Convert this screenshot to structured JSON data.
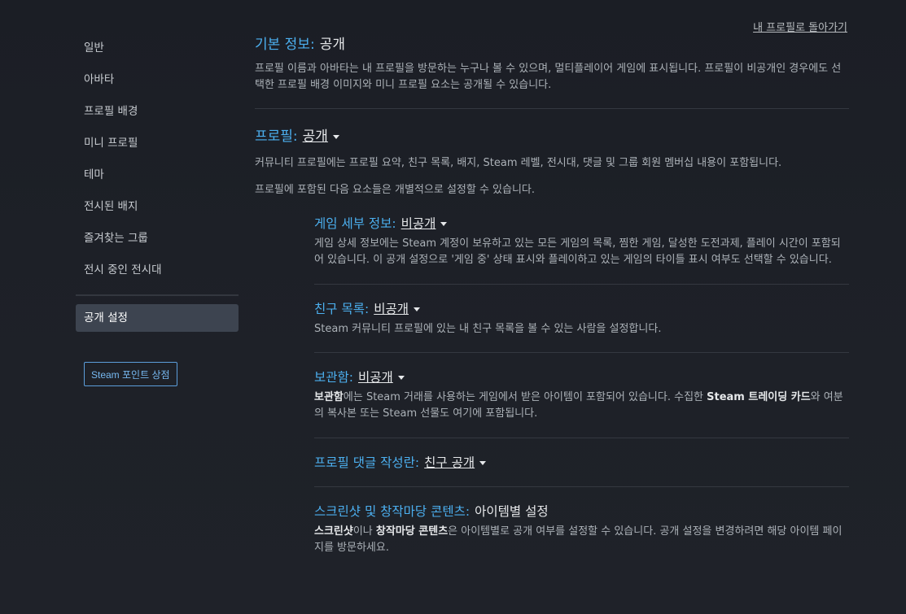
{
  "sidebar": {
    "items": [
      {
        "label": "일반"
      },
      {
        "label": "아바타"
      },
      {
        "label": "프로필 배경"
      },
      {
        "label": "미니 프로필"
      },
      {
        "label": "테마"
      },
      {
        "label": "전시된 배지"
      },
      {
        "label": "즐겨찾는 그룹"
      },
      {
        "label": "전시 중인 전시대"
      }
    ],
    "active_item": "공개 설정",
    "points_button": "Steam 포인트 상점"
  },
  "header": {
    "back_link": "내 프로필로 돌아가기"
  },
  "basic_info": {
    "title": "기본 정보:",
    "value": "공개",
    "description": "프로필 이름과 아바타는 내 프로필을 방문하는 누구나 볼 수 있으며, 멀티플레이어 게임에 표시됩니다. 프로필이 비공개인 경우에도 선택한 프로필 배경 이미지와 미니 프로필 요소는 공개될 수 있습니다."
  },
  "profile": {
    "title": "프로필:",
    "value": "공개",
    "description": "커뮤니티 프로필에는 프로필 요약, 친구 목록, 배지, Steam 레벨, 전시대, 댓글 및 그룹 회원 멤버십 내용이 포함됩니다.",
    "note": "프로필에 포함된 다음 요소들은 개별적으로 설정할 수 있습니다."
  },
  "game_details": {
    "title": "게임 세부 정보:",
    "value": "비공개",
    "description": "게임 상세 정보에는 Steam 계정이 보유하고 있는 모든 게임의 목록, 찜한 게임, 달성한 도전과제, 플레이 시간이 포함되어 있습니다. 이 공개 설정으로 '게임 중' 상태 표시와 플레이하고 있는 게임의 타이틀 표시 여부도 선택할 수 있습니다."
  },
  "friends_list": {
    "title": "친구 목록:",
    "value": "비공개",
    "description": "Steam 커뮤니티 프로필에 있는 내 친구 목록을 볼 수 있는 사람을 설정합니다."
  },
  "inventory": {
    "title": "보관함:",
    "value": "비공개",
    "desc_b1": "보관함",
    "desc_t1": "에는 Steam 거래를 사용하는 게임에서 받은 아이템이 포함되어 있습니다. 수집한 ",
    "desc_b2": "Steam 트레이딩 카드",
    "desc_t2": "와 여분의 복사본 또는 Steam 선물도 여기에 포함됩니다."
  },
  "comments": {
    "title": "프로필 댓글 작성란:",
    "value": "친구 공개"
  },
  "screenshots": {
    "title": "스크린샷 및 창작마당 콘텐츠:",
    "value": "아이템별 설정",
    "desc_b1": "스크린샷",
    "desc_t1": "이나 ",
    "desc_b2": "창작마당 콘텐츠",
    "desc_t2": "은 아이템별로 공개 여부를 설정할 수 있습니다. 공개 설정을 변경하려면 해당 아이템 페이지를 방문하세요."
  }
}
